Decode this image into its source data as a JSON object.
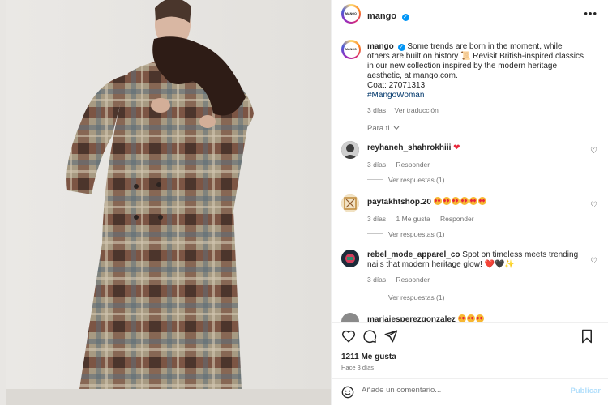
{
  "post": {
    "account": "mango",
    "avatar_text": "MANGO",
    "more_glyph": "•••",
    "verified_glyph": "✓"
  },
  "caption": {
    "user": "mango",
    "text": "Some trends are born in the moment, while others are built on history 📜 Revisit British-inspired classics in our new collection inspired by the modern heritage aesthetic, at mango.com.",
    "coat": "Coat: 27071313",
    "hashtag": "#MangoWoman",
    "age": "3 días",
    "translate": "Ver traducción"
  },
  "filter_label": "Para ti",
  "comments": [
    {
      "user": "reyhaneh_shahrokhiii",
      "text": "",
      "age": "3 días",
      "likes": "",
      "reply": "Responder",
      "replies": "Ver respuestas (1)",
      "avatar_color": "#3d3d3d"
    },
    {
      "user": "paytakhtshop.20",
      "text": "",
      "age": "3 días",
      "likes": "1 Me gusta",
      "reply": "Responder",
      "replies": "Ver respuestas (1)",
      "avatar_color": "#c9a063"
    },
    {
      "user": "rebel_mode_apparel_co",
      "text": "Spot on timeless meets trending nails that modern heritage glow! ❤️🖤✨",
      "age": "3 días",
      "likes": "",
      "reply": "Responder",
      "replies": "Ver respuestas (1)",
      "avatar_color": "#1c2b3a"
    },
    {
      "user": "mariajesperezgonzalez",
      "text": "",
      "avatar_color": "#8a8a8a"
    }
  ],
  "stats": {
    "likes": "1211 Me gusta",
    "age": "Hace 3 días"
  },
  "compose": {
    "placeholder": "Añade un comentario...",
    "publish": "Publicar"
  },
  "icons": [
    "heart-icon",
    "comment-icon",
    "share-icon",
    "bookmark-icon",
    "emoji-icon",
    "more-icon",
    "verified-icon"
  ],
  "colors": {
    "link": "#00376b",
    "publish": "#b2dffc",
    "muted": "#737373",
    "verified": "#0095f6"
  }
}
